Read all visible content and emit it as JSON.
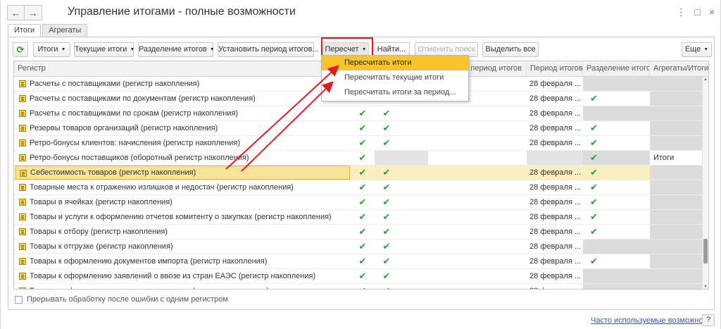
{
  "window": {
    "title": "Управление итогами - полные возможности",
    "nav_back": "←",
    "nav_forward": "→",
    "more_icon": "⋮",
    "maximize_icon": "□",
    "close_icon": "×"
  },
  "tabs": [
    {
      "label": "Итоги",
      "active": true
    },
    {
      "label": "Агрегаты",
      "active": false
    }
  ],
  "toolbar": {
    "refresh_icon": "⟳",
    "itogi_label": "Итоги",
    "tekushie_label": "Текущие итоги",
    "razdelenie_label": "Разделение итогов",
    "ustanovit_label": "Установить период итогов...",
    "pereschet_label": "Пересчет",
    "nayti_label": "Найти...",
    "otmenit_label": "Отменить поиск",
    "vydelit_label": "Выделить все",
    "eshe_label": "Еще",
    "dropdown_arrow": "▼"
  },
  "table": {
    "headers": {
      "register": "Регистр",
      "period_min": "ый период итогов",
      "period": "Период итогов",
      "separation": "Разделение итогов",
      "aggregates": "Агрегаты/Итоги"
    },
    "check_glyph": "✔",
    "rows": [
      {
        "name": "Расчеты с поставщиками (регистр накопления)",
        "use": false,
        "cur": false,
        "period": "28 февраля ...",
        "sep": false,
        "agg": ""
      },
      {
        "name": "Расчеты с поставщиками по документам (регистр накопления)",
        "use": false,
        "cur": false,
        "period": "28 февраля ...",
        "sep": true,
        "agg": ""
      },
      {
        "name": "Расчеты с поставщиками по срокам (регистр накопления)",
        "use": true,
        "cur": true,
        "period": "28 февраля ...",
        "sep": false,
        "agg": ""
      },
      {
        "name": "Резервы товаров организаций (регистр накопления)",
        "use": true,
        "cur": true,
        "period": "28 февраля ...",
        "sep": true,
        "agg": ""
      },
      {
        "name": "Ретро-бонусы клиентов: начисления (регистр накопления)",
        "use": true,
        "cur": true,
        "period": "28 февраля ...",
        "sep": true,
        "agg": ""
      },
      {
        "name": "Ретро-бонусы поставщиков (оборотный регистр накопления)",
        "use": true,
        "cur": false,
        "period": "",
        "sep": true,
        "agg": "Итоги"
      },
      {
        "name": "Себестоимость товаров (регистр накопления)",
        "use": true,
        "cur": true,
        "period": "28 февраля ...",
        "sep": true,
        "agg": ""
      },
      {
        "name": "Товарные места к отражению излишков и недостач (регистр накопления)",
        "use": true,
        "cur": true,
        "period": "28 февраля ...",
        "sep": true,
        "agg": ""
      },
      {
        "name": "Товары в ячейках (регистр накопления)",
        "use": true,
        "cur": true,
        "period": "28 февраля ...",
        "sep": true,
        "agg": ""
      },
      {
        "name": "Товары и услуги к оформлению отчетов комитенту о закупках (регистр накопления)",
        "use": true,
        "cur": true,
        "period": "28 февраля ...",
        "sep": true,
        "agg": ""
      },
      {
        "name": "Товары к отбору (регистр накопления)",
        "use": true,
        "cur": true,
        "period": "28 февраля ...",
        "sep": true,
        "agg": ""
      },
      {
        "name": "Товары к отгрузке (регистр накопления)",
        "use": true,
        "cur": true,
        "period": "28 февраля ...",
        "sep": false,
        "agg": ""
      },
      {
        "name": "Товары к оформлению документов импорта (регистр накопления)",
        "use": true,
        "cur": true,
        "period": "28 февраля ...",
        "sep": true,
        "agg": ""
      },
      {
        "name": "Товары к оформлению заявлений о ввозе из стран ЕАЭС (регистр накопления)",
        "use": true,
        "cur": true,
        "period": "28 февраля ...",
        "sep": false,
        "agg": ""
      },
      {
        "name": "Товары к оформлению излишков и недостач (регистр накопления)",
        "use": true,
        "cur": true,
        "period": "28 февраля ...",
        "sep": false,
        "agg": ""
      }
    ]
  },
  "dropdown": {
    "items": [
      {
        "label": "Пересчитать итоги",
        "active": true
      },
      {
        "label": "Пересчитать текущие итоги",
        "active": false
      },
      {
        "label": "Пересчитать итоги за период...",
        "active": false
      }
    ]
  },
  "footer": {
    "checkbox_label": "Прерывать обработку после ошибки с одним регистром",
    "link_label": "Часто используемые возможности",
    "help_label": "?"
  },
  "colors": {
    "highlight": "#e31b1b",
    "check": "#2c9e2c",
    "selected_row": "#fbeec1",
    "menu_active": "#f7c52b"
  }
}
